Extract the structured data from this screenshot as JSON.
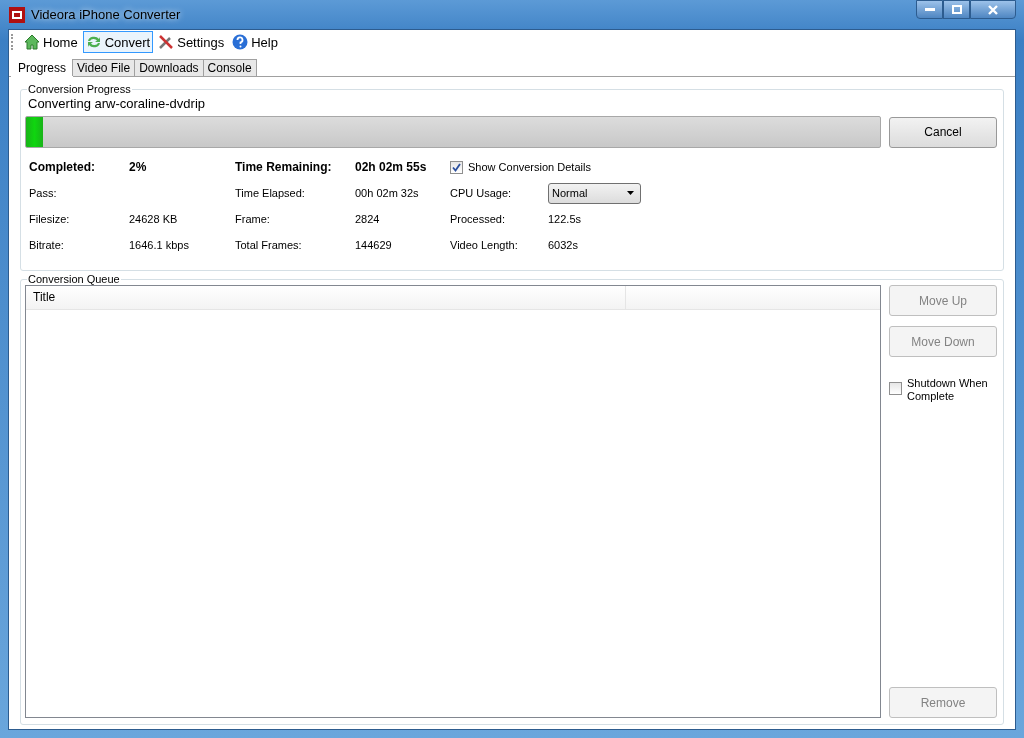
{
  "window": {
    "title": "Videora iPhone Converter"
  },
  "toolbar": [
    {
      "label": "Home",
      "kind": "home",
      "selected": false
    },
    {
      "label": "Convert",
      "kind": "convert",
      "selected": true
    },
    {
      "label": "Settings",
      "kind": "settings",
      "selected": false
    },
    {
      "label": "Help",
      "kind": "help",
      "selected": false
    }
  ],
  "tabs": [
    {
      "label": "Progress",
      "selected": true
    },
    {
      "label": "Video File",
      "selected": false
    },
    {
      "label": "Downloads",
      "selected": false
    },
    {
      "label": "Console",
      "selected": false
    }
  ],
  "progress": {
    "group_title": "Conversion Progress",
    "status": "Converting arw-coraline-dvdrip",
    "level": 0.02,
    "cancel_button": {
      "label": "Cancel",
      "disabled": false
    },
    "summary": {
      "completed": {
        "label": "Completed:",
        "value": "2%"
      },
      "time_remaining": {
        "label": "Time Remaining:",
        "value": "02h 02m 55s"
      },
      "show_details": {
        "label": "Show Conversion Details",
        "checked": true
      }
    },
    "details": [
      [
        {
          "label": "Pass:"
        },
        {
          "label": "Time Elapsed:",
          "value": "00h 02m 32s"
        },
        {
          "label": "CPU Usage:",
          "value": "Normal",
          "kind": "dropdown"
        }
      ],
      [
        {
          "label": "Filesize:",
          "value": "24628 KB"
        },
        {
          "label": "Frame:",
          "value": "2824"
        },
        {
          "label": "Processed:",
          "value": "122.5s"
        }
      ],
      [
        {
          "label": "Bitrate:",
          "value": "1646.1 kbps"
        },
        {
          "label": "Total Frames:",
          "value": "144629"
        },
        {
          "label": "Video Length:",
          "value": "6032s"
        }
      ]
    ]
  },
  "queue": {
    "group_title": "Conversion Queue",
    "columns": [
      "Title"
    ],
    "buttons": [
      {
        "label": "Move Up",
        "disabled": true
      },
      {
        "label": "Move Down",
        "disabled": true
      }
    ],
    "shutdown": {
      "label": "Shutdown When Complete",
      "checked": false
    },
    "remove_button": {
      "label": "Remove",
      "disabled": true
    }
  }
}
